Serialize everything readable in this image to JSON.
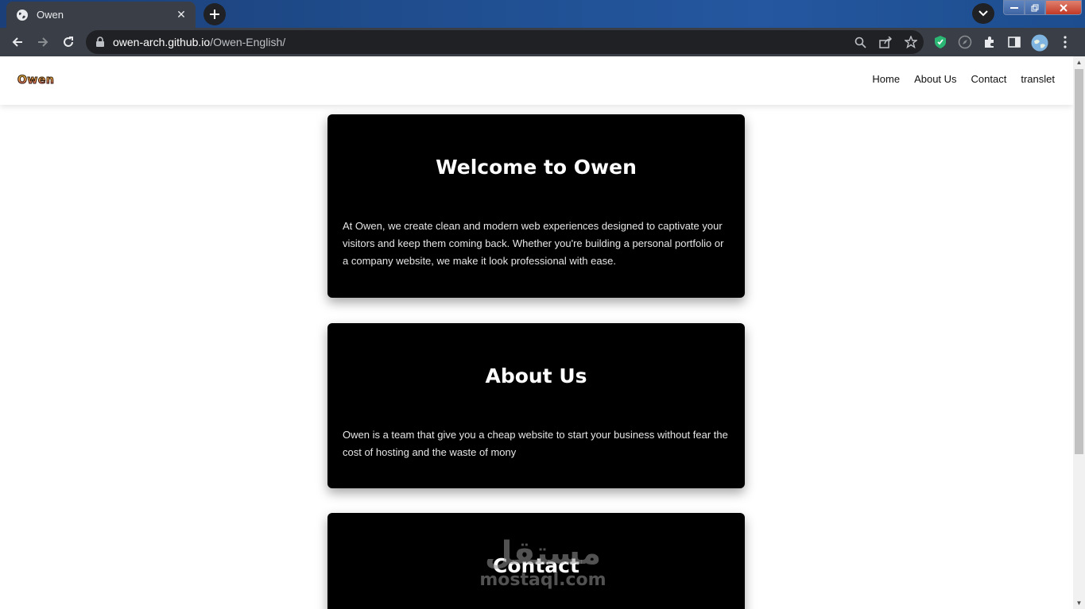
{
  "browser": {
    "tab": {
      "title": "Owen"
    },
    "address": {
      "host": "owen-arch.github.io",
      "path": "/Owen-English/"
    }
  },
  "site": {
    "logo_text": "Owen",
    "nav": [
      {
        "label": "Home"
      },
      {
        "label": "About Us"
      },
      {
        "label": "Contact"
      },
      {
        "label": "translet"
      }
    ],
    "sections": [
      {
        "title": "Welcome to Owen",
        "body": "At Owen, we create clean and modern web experiences designed to captivate your visitors and keep them coming back. Whether you're building a personal portfolio or a company website, we make it look professional with ease."
      },
      {
        "title": "About Us",
        "body": "Owen is a team that give you a cheap website to start your business without fear the cost of hosting and the waste of mony"
      },
      {
        "title": "Contact"
      }
    ]
  },
  "watermark": {
    "arabic": "مستقل",
    "latin": "mostaql.com"
  },
  "colors": {
    "tab_bg": "#3a3f47",
    "card_bg": "#000000",
    "page_bg": "#ffffff"
  }
}
